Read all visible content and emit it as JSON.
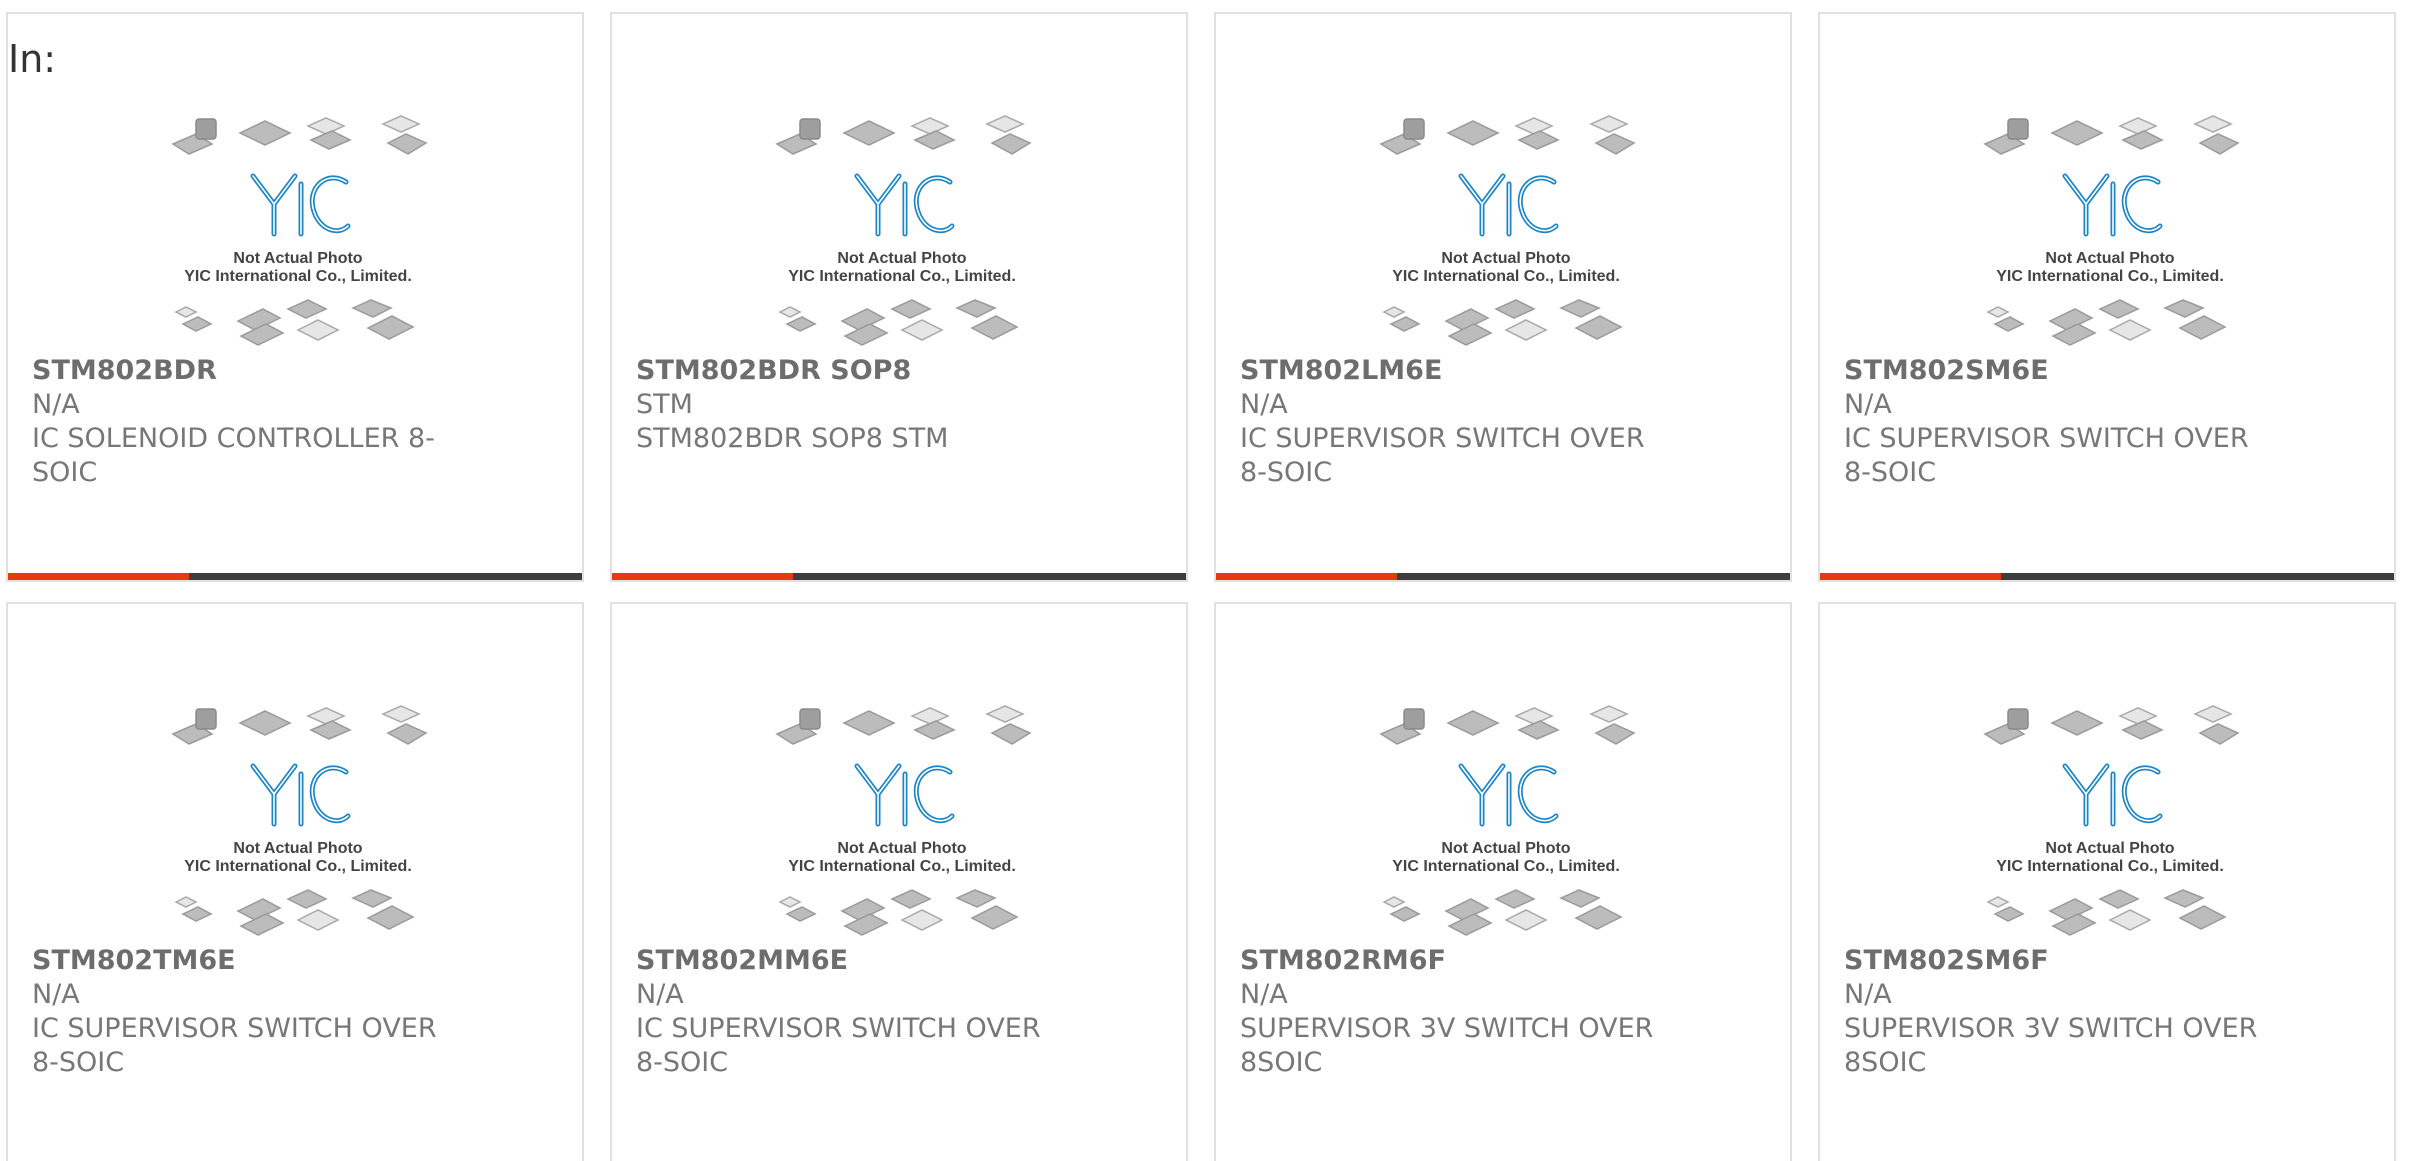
{
  "header": {
    "in_label": "In:"
  },
  "placeholder": {
    "line1": "Not Actual Photo",
    "line2": "YIC International Co., Limited.",
    "logo_text": "YIC"
  },
  "theme": {
    "accent": "#e8380d",
    "bar": "#3e3e3e",
    "border": "#e1e1e1",
    "text": "#777777"
  },
  "progress_fraction": 0.315,
  "products": [
    {
      "part": "STM802BDR",
      "mfr": "N/A",
      "desc_line1": "IC SOLENOID CONTROLLER 8-",
      "desc_line2": "SOIC"
    },
    {
      "part": "STM802BDR SOP8",
      "mfr": "STM",
      "desc_line1": "STM802BDR SOP8 STM",
      "desc_line2": ""
    },
    {
      "part": "STM802LM6E",
      "mfr": "N/A",
      "desc_line1": "IC SUPERVISOR SWITCH OVER",
      "desc_line2": "8-SOIC"
    },
    {
      "part": "STM802SM6E",
      "mfr": "N/A",
      "desc_line1": "IC SUPERVISOR SWITCH OVER",
      "desc_line2": "8-SOIC"
    },
    {
      "part": "STM802TM6E",
      "mfr": "N/A",
      "desc_line1": "IC SUPERVISOR SWITCH OVER",
      "desc_line2": "8-SOIC"
    },
    {
      "part": "STM802MM6E",
      "mfr": "N/A",
      "desc_line1": "IC SUPERVISOR SWITCH OVER",
      "desc_line2": "8-SOIC"
    },
    {
      "part": "STM802RM6F",
      "mfr": "N/A",
      "desc_line1": "SUPERVISOR 3V SWITCH OVER",
      "desc_line2": "8SOIC"
    },
    {
      "part": "STM802SM6F",
      "mfr": "N/A",
      "desc_line1": "SUPERVISOR 3V SWITCH OVER",
      "desc_line2": "8SOIC"
    }
  ]
}
